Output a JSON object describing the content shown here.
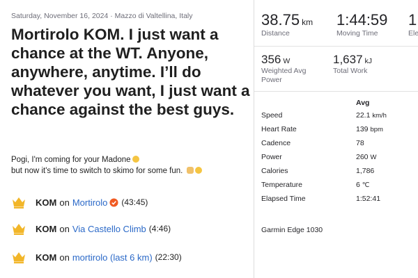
{
  "activity": {
    "meta": "Saturday, November 16, 2024 · Mazzo di Valtellina, Italy",
    "title": "Mortirolo KOM. I just want a chance at the WT. Anyone, anywhere, anytime. I’ll do whatever you want, I just want a chance against the best guys.",
    "description_line1": "Pogi, I'm coming for your Madone",
    "description_line2": "but now it's time to switch to skimo for some fun."
  },
  "achievements": [
    {
      "badge": "KOM",
      "on": "on",
      "segment": "Mortirolo",
      "time": "(43:45)",
      "verified": true
    },
    {
      "badge": "KOM",
      "on": "on",
      "segment": "Via Castello Climb",
      "time": "(4:46)",
      "verified": false
    },
    {
      "badge": "KOM",
      "on": "on",
      "segment": "mortirolo (last 6 km)",
      "time": "(22:30)",
      "verified": false
    }
  ],
  "stats": {
    "distance": {
      "value": "38.75",
      "unit": "km",
      "label": "Distance"
    },
    "moving_time": {
      "value": "1:44:59",
      "label": "Moving Time"
    },
    "elevation": {
      "value": "1",
      "label": "Ele"
    },
    "weighted_power": {
      "value": "356",
      "unit": "W",
      "label_line1": "Weighted Avg",
      "label_line2": "Power"
    },
    "total_work": {
      "value": "1,637",
      "unit": "kJ",
      "label": "Total Work"
    }
  },
  "details": {
    "avg_header": "Avg",
    "rows": [
      {
        "label": "Speed",
        "value": "22.1",
        "unit": "km/h"
      },
      {
        "label": "Heart Rate",
        "value": "139",
        "unit": "bpm"
      },
      {
        "label": "Cadence",
        "value": "78",
        "unit": ""
      },
      {
        "label": "Power",
        "value": "260",
        "unit": "W"
      },
      {
        "label": "Calories",
        "value": "1,786",
        "unit": ""
      },
      {
        "label": "Temperature",
        "value": "6",
        "unit": "℃"
      },
      {
        "label": "Elapsed Time",
        "value": "1:52:41",
        "unit": ""
      }
    ],
    "device": "Garmin Edge 1030"
  },
  "colors": {
    "link": "#2b69c8",
    "crown": "#f2b629",
    "verified": "#f05a22"
  }
}
